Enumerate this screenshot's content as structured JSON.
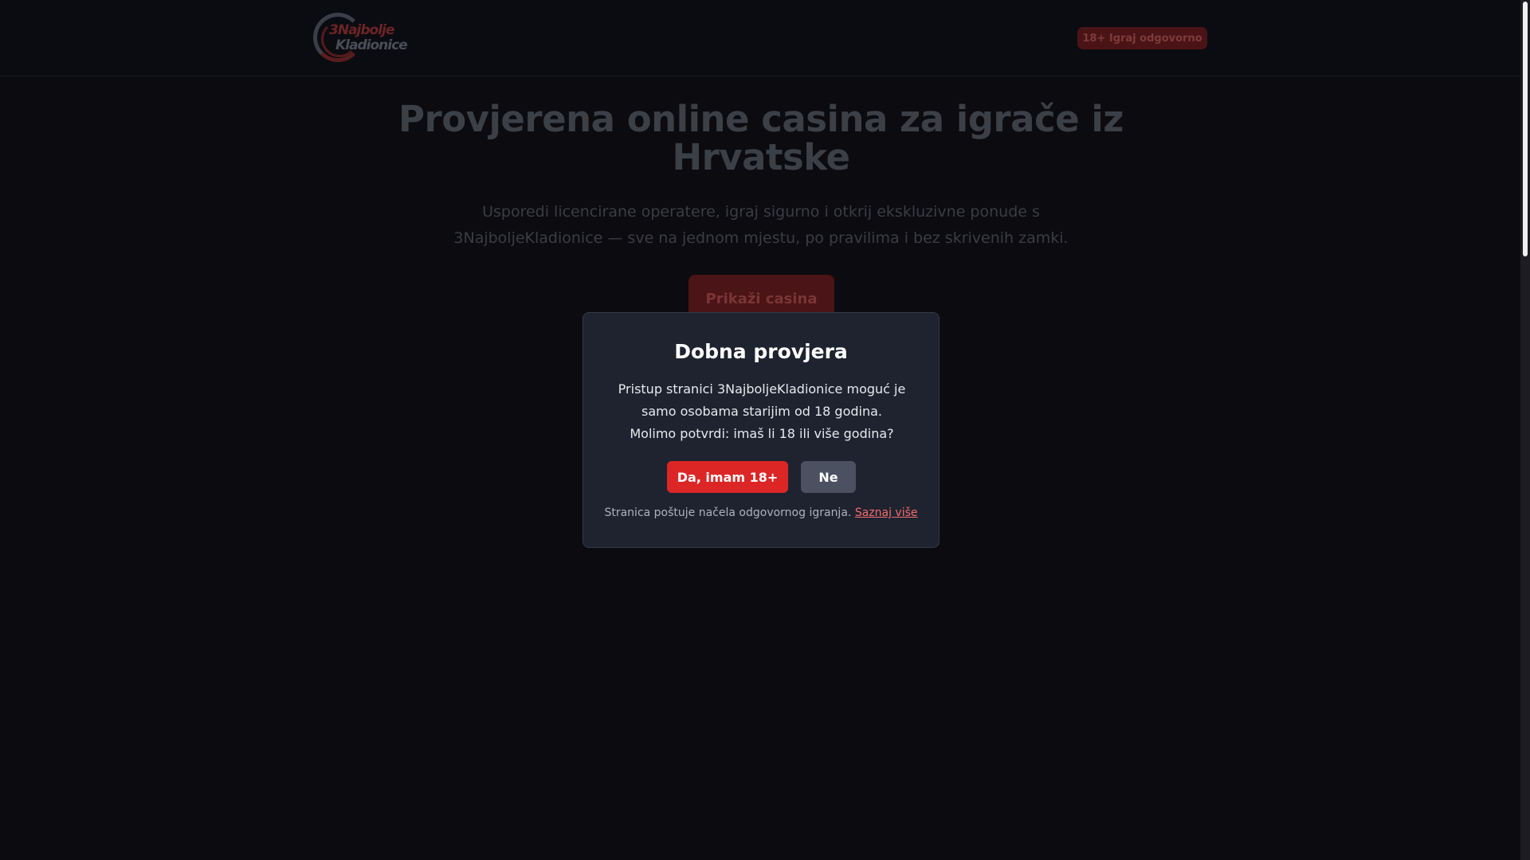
{
  "header": {
    "logo_line1_a": "3",
    "logo_line1_b": "Najbolje",
    "logo_line2": "Kladionice",
    "responsible_badge": "18+ Igraj odgovorno"
  },
  "hero": {
    "title": "Provjerena online casina za igrače iz Hrvatske",
    "subtitle": "Usporedi licencirane operatere, igraj sigurno i otkrij ekskluzivne ponude s 3NajboljeKladionice — sve na jednom mjestu, po pravilima i bez skrivenih zamki.",
    "cta_label": "Prikaži casina"
  },
  "modal": {
    "title": "Dobna provjera",
    "text_line1": "Pristup stranici 3NajboljeKladionice moguć je",
    "text_line2": "samo osobama starijim od 18 godina.",
    "text_line3": "Molimo potvrdi: imaš li 18 ili više godina?",
    "yes_label": "Da, imam 18+",
    "no_label": "Ne",
    "footer_text": "Stranica poštuje načela odgovornog igranja.",
    "footer_link": "Saznaj više"
  },
  "colors": {
    "accent": "#dc2626",
    "modal_bg": "#1f2330",
    "page_bg": "#0b0b10",
    "link": "#f26d6d"
  }
}
